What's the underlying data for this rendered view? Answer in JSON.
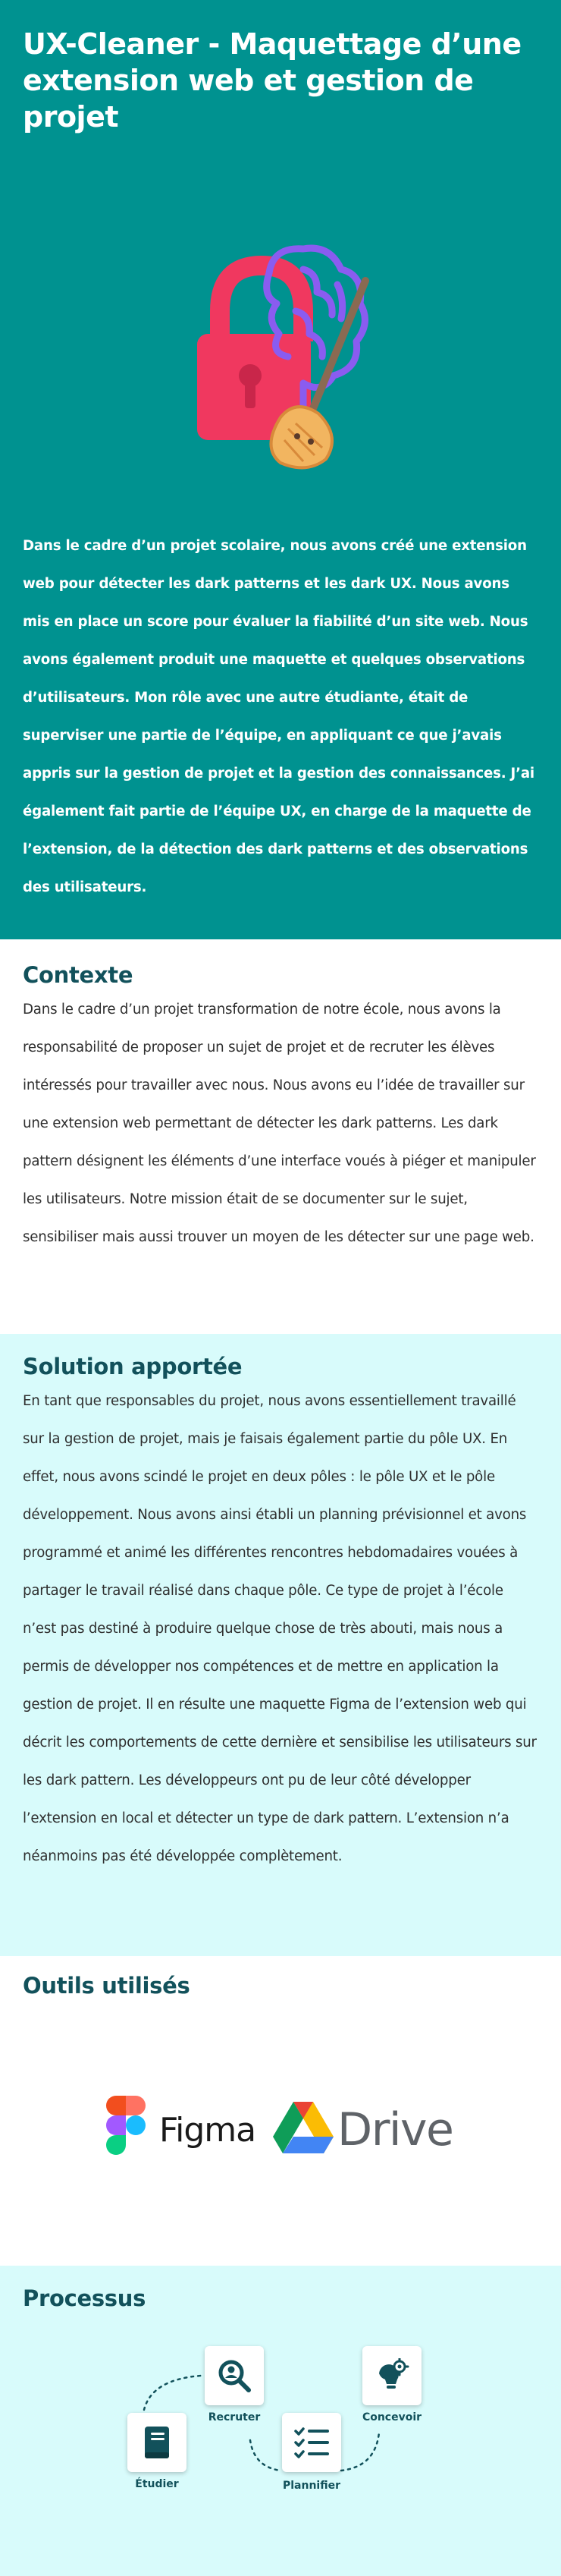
{
  "hero": {
    "title": "UX-Cleaner - Maquettage d’une extension web et gestion de projet",
    "logo_icon": "lock-brain-broom-icon",
    "intro": "Dans le cadre d’un projet scolaire, nous avons créé une extension web pour détecter les dark patterns et les dark UX. Nous avons mis en place un score pour évaluer la fiabilité d’un site web. Nous avons également produit une maquette et quelques observations d’utilisateurs. Mon rôle avec une autre étudiante, était de superviser une partie de l’équipe, en appliquant ce que j’avais appris sur la gestion de projet et la gestion des connaissances. J’ai également fait partie de l’équipe UX, en charge de la maquette de l’extension, de la détection des dark patterns et des observations des utilisateurs."
  },
  "contexte": {
    "heading": "Contexte",
    "body": "Dans le cadre d’un projet transformation de notre école, nous avons la responsabilité de proposer un sujet de projet et de recruter les élèves intéressés pour travailler avec nous. Nous avons eu l’idée de travailler sur une extension web permettant de détecter les dark patterns. Les dark pattern désignent les éléments d’une interface voués à piéger et manipuler les utilisateurs. Notre mission était de se documenter sur le sujet, sensibiliser mais aussi trouver un moyen de les détecter sur une page web."
  },
  "solution": {
    "heading": "Solution apportée",
    "body": "En tant que responsables du projet, nous avons essentiellement travaillé sur la gestion de projet, mais je faisais également partie du pôle  UX. En effet, nous avons scindé le projet en deux pôles : le pôle UX et le pôle développement. Nous avons ainsi établi un planning prévisionnel et avons programmé et animé les différentes rencontres hebdomadaires vouées à partager le travail réalisé dans chaque pôle. Ce type de projet à l’école n’est pas destiné à produire quelque chose de très abouti, mais nous a permis de développer nos compétences et de mettre en application la gestion de projet. Il en résulte une maquette Figma de l’extension web qui décrit les comportements de cette dernière et sensibilise les utilisateurs sur les dark pattern. Les développeurs ont pu de leur côté développer l’extension en local et détecter un type de dark pattern. L’extension n’a néanmoins pas été développée complètement."
  },
  "outils": {
    "heading": "Outils utilisés",
    "tools": [
      {
        "name": "Figma",
        "icon": "figma-logo-icon"
      },
      {
        "name": "Drive",
        "icon": "google-drive-logo-icon"
      }
    ]
  },
  "processus": {
    "heading": "Processus",
    "steps": [
      {
        "label": "Étudier",
        "icon": "book-icon"
      },
      {
        "label": "Recruter",
        "icon": "search-person-icon"
      },
      {
        "label": "Plannifier",
        "icon": "checklist-icon"
      },
      {
        "label": "Concevoir",
        "icon": "lightbulb-gear-icon"
      }
    ]
  },
  "colors": {
    "hero_bg": "#009290",
    "light_section_bg": "#d8fbfb",
    "heading": "#12515b",
    "text": "#2f2f2f"
  }
}
